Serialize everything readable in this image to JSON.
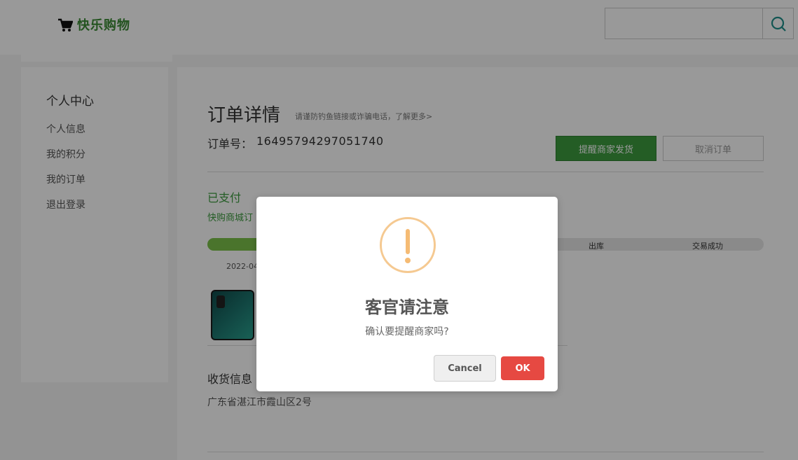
{
  "header": {
    "logo_text": "快乐购物",
    "search": {
      "value": "",
      "placeholder": ""
    }
  },
  "sidebar": {
    "title": "个人中心",
    "items": [
      {
        "label": "个人信息"
      },
      {
        "label": "我的积分"
      },
      {
        "label": "我的订单"
      },
      {
        "label": "退出登录"
      }
    ]
  },
  "order": {
    "title": "订单详情",
    "tip": "请谨防钓鱼链接或诈骗电话，了解更多>",
    "number_label": "订单号：",
    "number": "16495794297051740",
    "remind_button": "提醒商家发货",
    "cancel_button": "取消订单",
    "status": "已支付",
    "status_sub": "快购商城订",
    "progress": {
      "fraction": 0.1,
      "steps": [
        "出库",
        "交易成功"
      ],
      "date": "2022-04"
    },
    "address_title": "收货信息",
    "address": "广东省湛江市霞山区2号"
  },
  "dialog": {
    "title": "客官请注意",
    "message": "确认要提醒商家吗?",
    "cancel_label": "Cancel",
    "ok_label": "OK"
  },
  "colors": {
    "brand_green": "#3c9b3f",
    "progress_green": "#7cc24a",
    "ok_red": "#e64942",
    "warning_orange": "#f5c991"
  }
}
